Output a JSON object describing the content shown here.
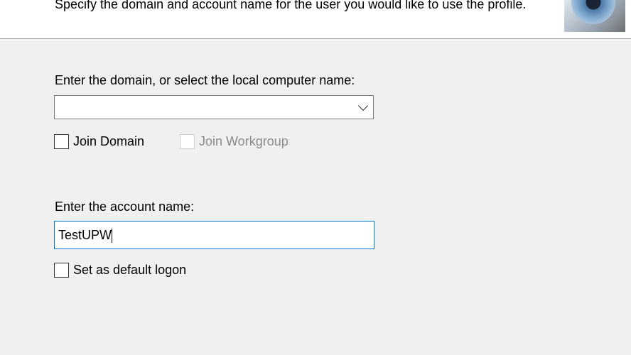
{
  "header": {
    "description": "Specify the domain and account name for the user you would like to use the profile.",
    "image_icon": "eye-image"
  },
  "domain": {
    "label": "Enter the domain, or select the local computer name:",
    "value": "",
    "icon": "chevron-down-icon"
  },
  "join_domain": {
    "label": "Join Domain",
    "checked": false
  },
  "join_workgroup": {
    "label": "Join Workgroup",
    "checked": false,
    "disabled": true
  },
  "account": {
    "label": "Enter the account name:",
    "value": "TestUPW"
  },
  "default_logon": {
    "label": "Set as default logon",
    "checked": false
  }
}
